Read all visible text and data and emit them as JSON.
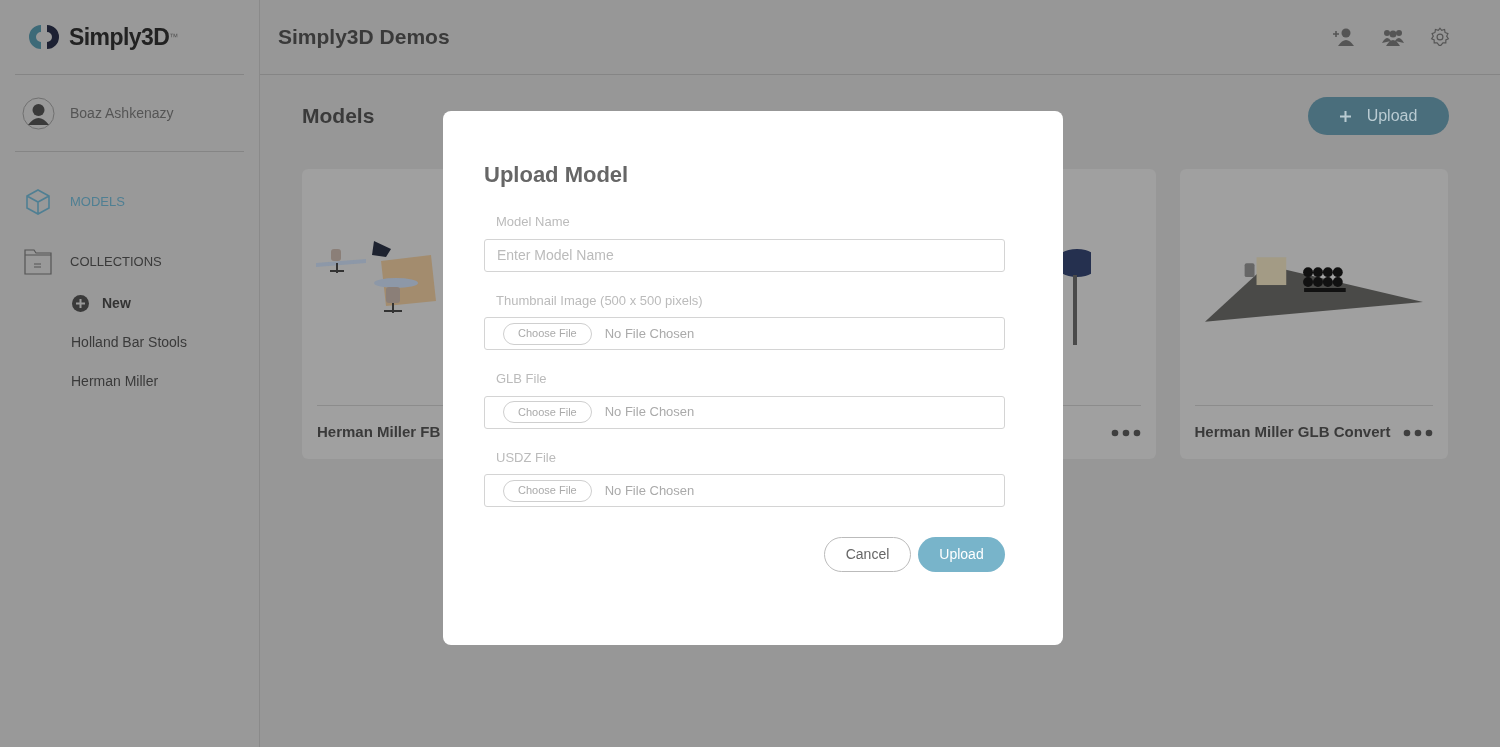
{
  "sidebar": {
    "brand": "Simply3D",
    "trademark": "™",
    "user": "Boaz Ashkenazy",
    "nav": [
      {
        "label": "MODELS",
        "kind": "models",
        "selected": true
      },
      {
        "label": "COLLECTIONS",
        "kind": "collections",
        "selected": false
      }
    ],
    "new_label": "New",
    "collections": [
      "Holland Bar Stools",
      "Herman Miller"
    ]
  },
  "header": {
    "title": "Simply3D Demos"
  },
  "page": {
    "title": "Models",
    "upload_button": "Upload",
    "cards": [
      {
        "kind": "picture",
        "title": "Herman Miller FB"
      },
      {
        "kind": "picture"
      },
      {
        "kind": "picture",
        "title": "Herman Miller GLB Convert"
      }
    ]
  },
  "modal": {
    "title": "Upload Model",
    "fields": [
      {
        "kind": "text",
        "label": "Model Name",
        "placeholder": "Enter Model Name"
      },
      {
        "kind": "file",
        "label": "Thumbnail Image (500 x 500 pixels)",
        "button": "Choose File",
        "status": "No File Chosen"
      },
      {
        "kind": "file",
        "label": "GLB File",
        "button": "Choose File",
        "status": "No File Chosen"
      },
      {
        "kind": "file",
        "label": "USDZ File",
        "button": "Choose File",
        "status": "No File Chosen"
      }
    ],
    "cancel": "Cancel",
    "submit": "Upload"
  }
}
